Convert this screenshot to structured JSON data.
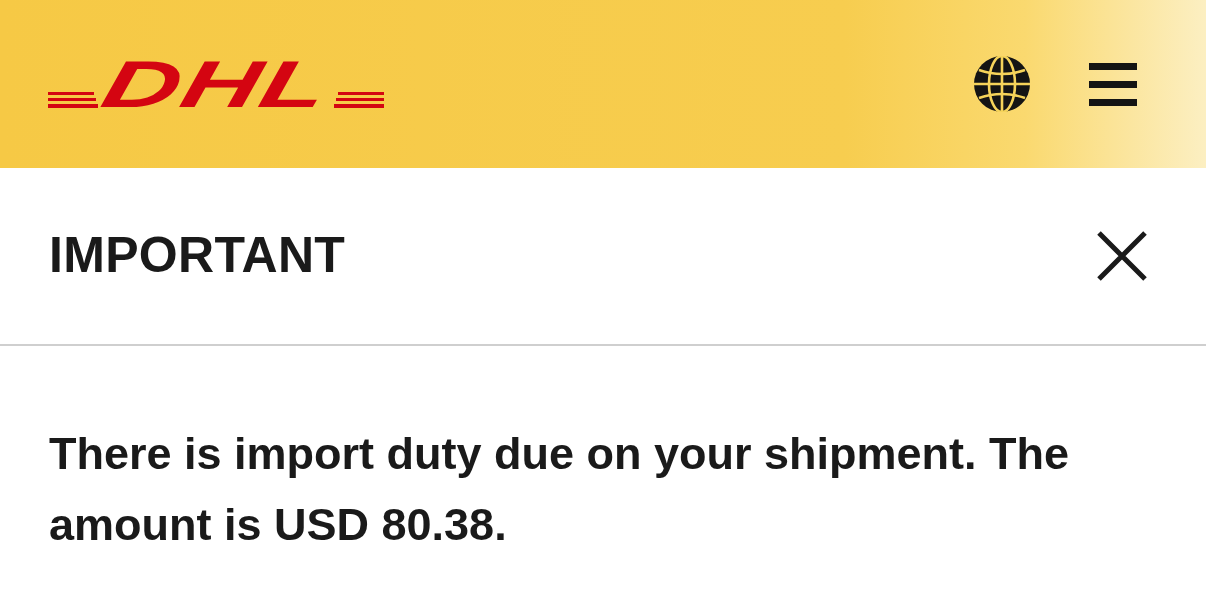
{
  "header": {
    "logo": "DHL"
  },
  "dialog": {
    "title": "IMPORTANT",
    "message": "There is import duty due on your shipment. The amount is USD 80.38."
  }
}
